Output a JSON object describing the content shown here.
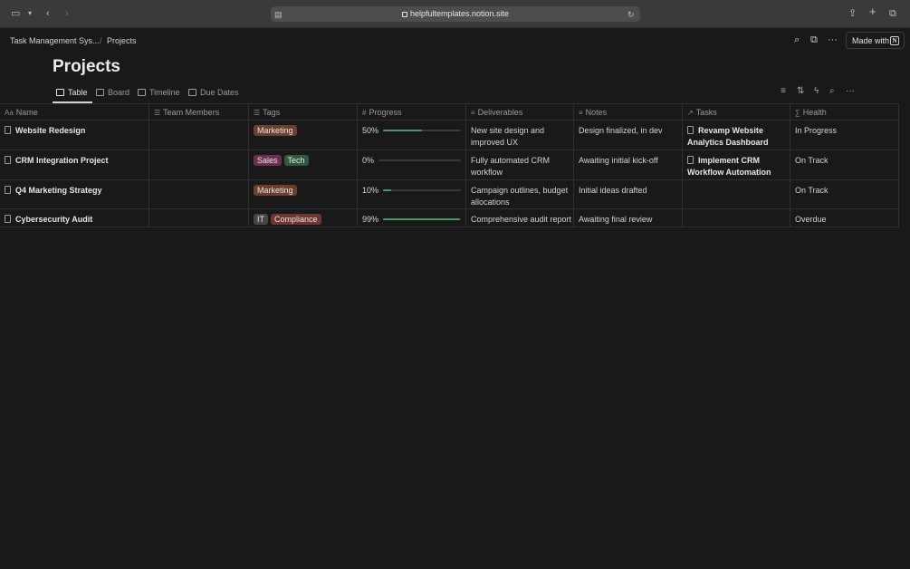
{
  "browser": {
    "url": "helpfultemplates.notion.site"
  },
  "breadcrumb": {
    "parent": "Task Management Sys...",
    "current": "Projects"
  },
  "topbar": {
    "made_with": "Made with",
    "logo_letter": "N"
  },
  "page": {
    "title": "Projects"
  },
  "tabs": [
    {
      "label": "Table",
      "active": true
    },
    {
      "label": "Board",
      "active": false
    },
    {
      "label": "Timeline",
      "active": false
    },
    {
      "label": "Due Dates",
      "active": false
    }
  ],
  "columns": {
    "name": {
      "icon": "Aa",
      "label": "Name"
    },
    "team": {
      "label": "Team Members"
    },
    "tags": {
      "label": "Tags"
    },
    "progress": {
      "icon": "#",
      "label": "Progress"
    },
    "deliverables": {
      "label": "Deliverables"
    },
    "notes": {
      "label": "Notes"
    },
    "tasks": {
      "label": "Tasks"
    },
    "health": {
      "icon": "∑",
      "label": "Health"
    }
  },
  "rows": [
    {
      "name": "Website Redesign",
      "tags": [
        {
          "label": "Marketing",
          "color": "#6b3f2a"
        }
      ],
      "progress_label": "50%",
      "progress": 0.5,
      "deliverables": "New site design and improved UX",
      "notes": "Design finalized, in dev",
      "task": "Revamp Website Analytics Dashboard",
      "health": "In Progress"
    },
    {
      "name": "CRM Integration Project",
      "tags": [
        {
          "label": "Sales",
          "color": "#6b3050"
        },
        {
          "label": "Tech",
          "color": "#2f5a3e"
        }
      ],
      "progress_label": "0%",
      "progress": 0,
      "deliverables": "Fully automated CRM workflow",
      "notes": "Awaiting initial kick-off",
      "task": "Implement CRM Workflow Automation",
      "health": "On Track"
    },
    {
      "name": "Q4 Marketing Strategy",
      "tags": [
        {
          "label": "Marketing",
          "color": "#6b3f2a"
        }
      ],
      "progress_label": "10%",
      "progress": 0.1,
      "deliverables": "Campaign outlines, budget allocations",
      "notes": "Initial ideas drafted",
      "task": "",
      "health": "On Track"
    },
    {
      "name": "Cybersecurity Audit",
      "tags": [
        {
          "label": "IT",
          "color": "#464646"
        },
        {
          "label": "Compliance",
          "color": "#6e3630"
        }
      ],
      "progress_label": "99%",
      "progress": 0.99,
      "deliverables": "Comprehensive audit report",
      "notes": "Awaiting final review",
      "task": "",
      "health": "Overdue"
    }
  ],
  "colors": {
    "background": "#191919",
    "progress_fill": "#4f9768"
  }
}
